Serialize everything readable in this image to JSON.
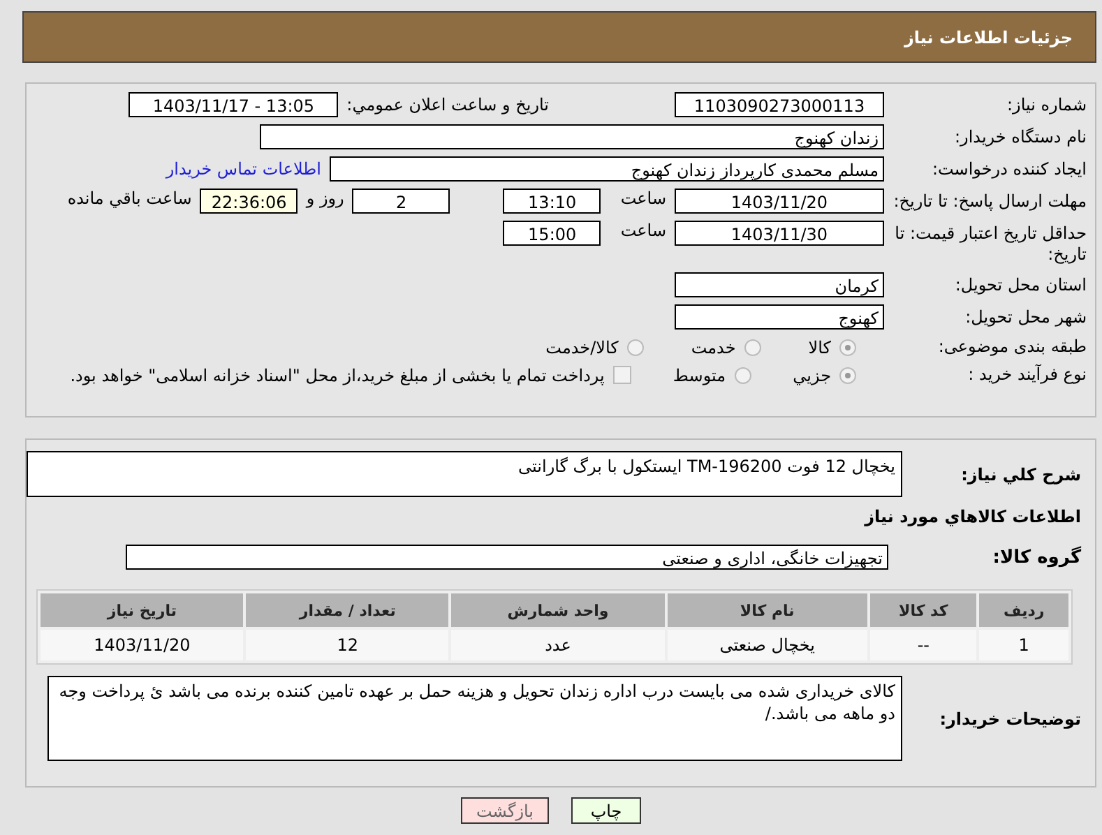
{
  "header": {
    "title": "جزئیات اطلاعات نیاز"
  },
  "need_number": {
    "label": "شماره نیاز:",
    "value": "1103090273000113"
  },
  "announce": {
    "label": "تاریخ و ساعت اعلان عمومي:",
    "value": "1403/11/17 - 13:05"
  },
  "buyer_org": {
    "label": "نام دستگاه خریدار:",
    "value": "زندان کهنوج"
  },
  "requester": {
    "label": "ایجاد کننده درخواست:",
    "value": "مسلم محمدی کارپرداز زندان کهنوج",
    "link": "اطلاعات تماس خریدار"
  },
  "deadline": {
    "label": "مهلت ارسال پاسخ: تا تاریخ:",
    "date": "1403/11/20",
    "time_label": "ساعت",
    "time": "13:10",
    "days": "2",
    "days_label": "روز و",
    "remaining": "22:36:06",
    "remaining_label": "ساعت باقي مانده"
  },
  "validity": {
    "label": "حداقل تاریخ اعتبار قیمت: تا تاریخ:",
    "date": "1403/11/30",
    "time_label": "ساعت",
    "time": "15:00"
  },
  "province": {
    "label": "استان محل تحویل:",
    "value": "کرمان"
  },
  "city": {
    "label": "شهر محل تحویل:",
    "value": "کهنوج"
  },
  "category": {
    "label": "طبقه بندی موضوعی:",
    "options": [
      {
        "label": "کالا",
        "selected": true
      },
      {
        "label": "خدمت",
        "selected": false
      },
      {
        "label": "کالا/خدمت",
        "selected": false
      }
    ]
  },
  "process": {
    "label": "نوع فرآیند خرید :",
    "options": [
      {
        "label": "جزيي",
        "selected": true
      },
      {
        "label": "متوسط",
        "selected": false
      }
    ],
    "payment": {
      "checked": false,
      "text": "پرداخت تمام یا بخشی از مبلغ خرید،از محل \"اسناد خزانه اسلامی\" خواهد بود."
    }
  },
  "description": {
    "label": "شرح کلي نياز:",
    "value": "یخچال 12 فوت TM-196200 ایستکول با برگ گارانتی"
  },
  "goods": {
    "title": "اطلاعات کالاهاي مورد نياز",
    "group_label": "گروه کالا:",
    "group": "تجهیزات خانگی، اداری و صنعتی",
    "columns": [
      "رديف",
      "کد کالا",
      "نام کالا",
      "واحد شمارش",
      "تعداد / مقدار",
      "تاريخ نياز"
    ],
    "rows": [
      [
        "1",
        "--",
        "یخچال صنعتی",
        "عدد",
        "12",
        "1403/11/20"
      ]
    ]
  },
  "notes": {
    "label": "توضیحات خریدار:",
    "value": "کالای خریداری شده می بایست درب اداره زندان تحویل و هزینه حمل بر عهده تامین کننده برنده می باشد ئ پرداخت وجه دو ماهه می باشد./"
  },
  "buttons": [
    {
      "label": "چاپ",
      "kind": "print"
    },
    {
      "label": "بازگشت",
      "kind": "back"
    }
  ]
}
